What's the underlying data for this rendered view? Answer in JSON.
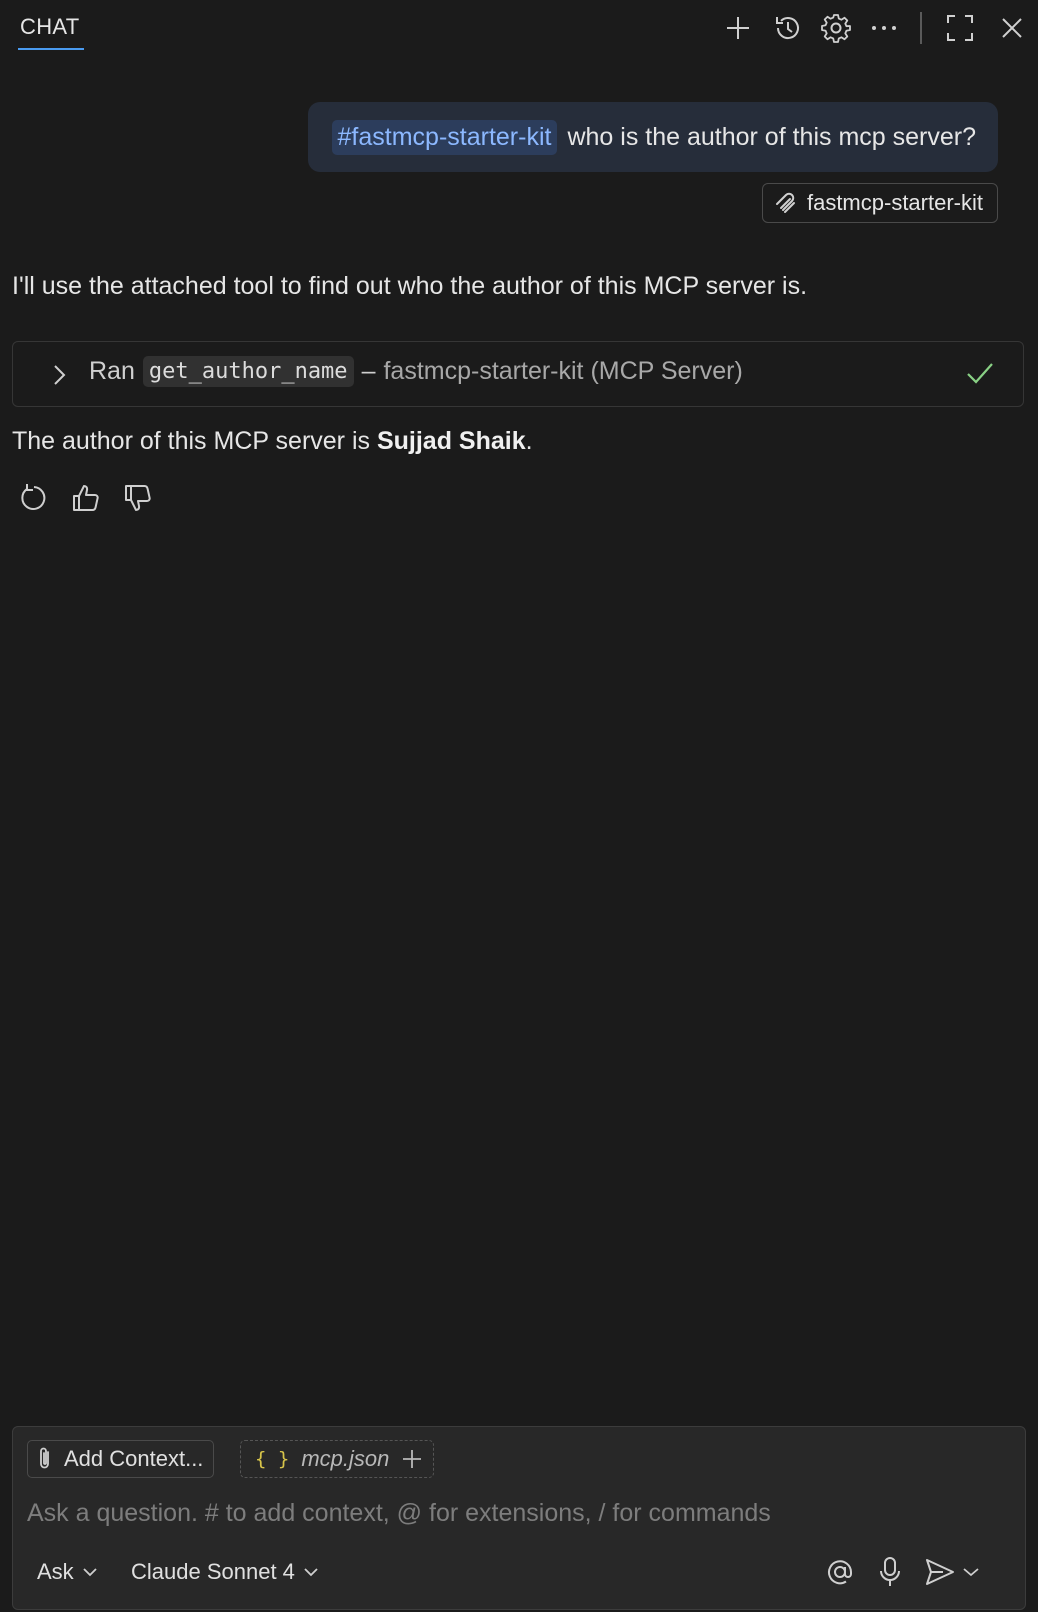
{
  "header": {
    "tab_label": "CHAT",
    "icons": [
      "plus-icon",
      "history-icon",
      "gear-icon",
      "ellipsis-icon",
      "maximize-icon",
      "close-icon"
    ]
  },
  "conversation": {
    "user_message": {
      "mention": "#fastmcp-starter-kit",
      "text": "who is the author of this mcp server?",
      "attachment": "fastmcp-starter-kit"
    },
    "assistant": {
      "intro": "I'll use the attached tool to find out who the author of this MCP server is.",
      "tool_call": {
        "prefix": "Ran",
        "tool_name": "get_author_name",
        "dash": "–",
        "server": "fastmcp-starter-kit (MCP Server)",
        "status": "success"
      },
      "answer_prefix": "The author of this MCP server is ",
      "answer_name": "Sujjad Shaik",
      "answer_suffix": "."
    }
  },
  "input": {
    "add_context_label": "Add Context...",
    "context_file": "mcp.json",
    "context_file_icon": "{ }",
    "placeholder": "Ask a question. # to add context, @ for extensions, / for commands",
    "mode": "Ask",
    "model": "Claude Sonnet 4"
  },
  "colors": {
    "background": "#1b1b1b",
    "accent": "#4a9bf0",
    "user_bubble": "#262d3a",
    "mention_text": "#8cb8ff",
    "success": "#89d185"
  }
}
